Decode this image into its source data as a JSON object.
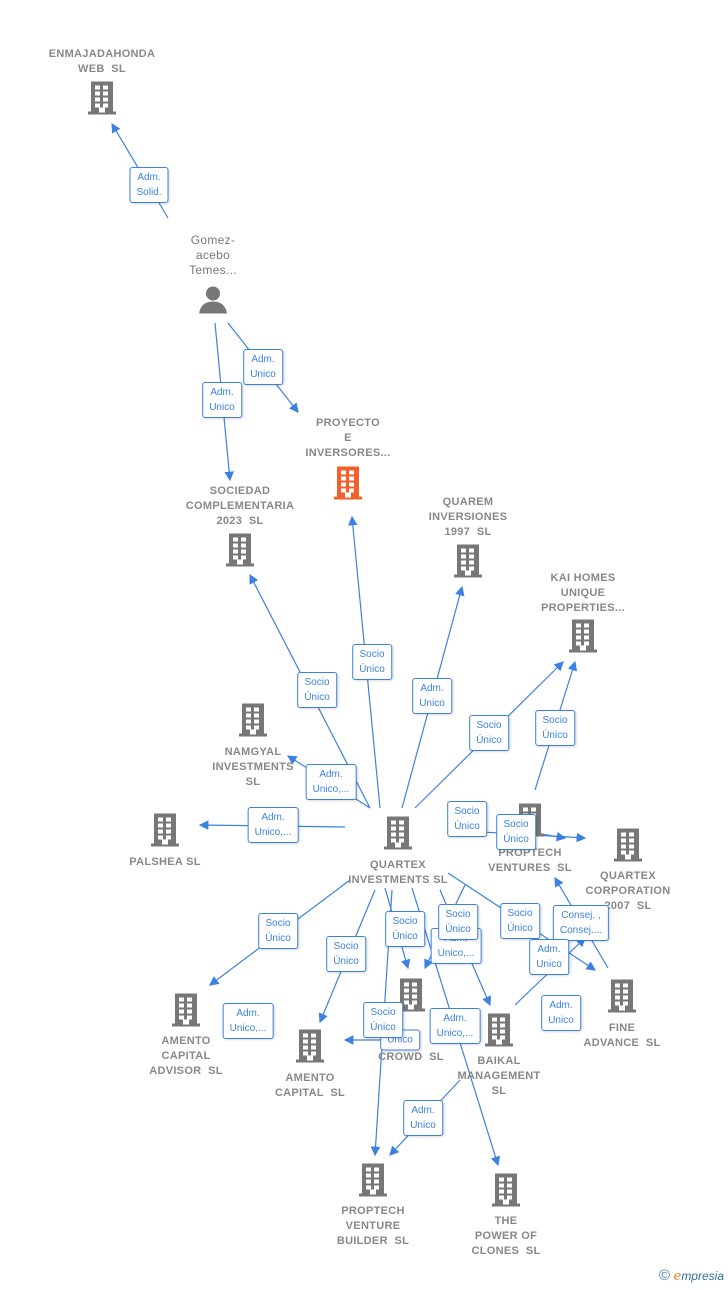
{
  "colors": {
    "edge": "#3b82e0",
    "company": "#777777",
    "highlight": "#f4602b",
    "person": "#777777"
  },
  "nodes": [
    {
      "type": "company",
      "label": "ENMAJADAHONDA\nWEB  SL"
    },
    {
      "type": "person",
      "label": "Gomez-\nacebo\nTemes..."
    },
    {
      "type": "company-highlight",
      "label": "PROYECTO\nE\nINVERSORES..."
    },
    {
      "type": "company",
      "label": "SOCIEDAD\nCOMPLEMENTARIA\n2023  SL"
    },
    {
      "type": "company",
      "label": "QUAREM\nINVERSIONES\n1997  SL"
    },
    {
      "type": "company",
      "label": "KAI HOMES\nUNIQUE\nPROPERTIES..."
    },
    {
      "type": "company",
      "label": "NAMGYAL\nINVESTMENTS\nSL"
    },
    {
      "type": "company",
      "label": "PALSHEA SL"
    },
    {
      "type": "company",
      "label": "QUARTEX\nINVESTMENTS SL"
    },
    {
      "type": "company",
      "label": "PROPTECH\nVENTURES  SL"
    },
    {
      "type": "company",
      "label": "QUARTEX\nCORPORATION\n2007  SL"
    },
    {
      "type": "company",
      "label": "AMENTO\nCAPITAL\nADVISOR  SL"
    },
    {
      "type": "company",
      "label": "AMENTO\nCAPITAL  SL"
    },
    {
      "type": "company",
      "label": "CROWD  SL"
    },
    {
      "type": "company",
      "label": "BAIKAL\nMANAGEMENT\nSL"
    },
    {
      "type": "company",
      "label": "FINE\nADVANCE  SL"
    },
    {
      "type": "company",
      "label": "PROPTECH\nVENTURE\nBUILDER  SL"
    },
    {
      "type": "company",
      "label": "THE\nPOWER OF\nCLONES  SL"
    }
  ],
  "edge_labels": [
    "Adm.\nSolid.",
    "Adm.\nUnico",
    "Adm.\nUnico",
    "Socio\nÚnico",
    "Socio\nÚnico",
    "Adm.\nUnico",
    "Socio\nÚnico",
    "Socio\nÚnico",
    "Adm.\nUnico,...",
    "Adm.\nUnico,...",
    "Socio\nÚnico",
    "Socio\nÚnico",
    "Socio\nÚnico",
    "Socio\nÚnico",
    "Adm.\nUnico,...",
    "Socio\nÚnico",
    "Socio\nÚnico",
    "Socio\nÚnico",
    "Consej. ,\nConsej....",
    "Adm.\nUnico",
    "Adm.\nUnico",
    "Adm.\nUnico,...",
    "Unico",
    "Socio\nÚnico",
    "Adm.\nUnico,...",
    "Adm.\nUnico"
  ],
  "footer": {
    "copyright": "©",
    "brand_e": "e",
    "brand_rest": "mpresia"
  }
}
